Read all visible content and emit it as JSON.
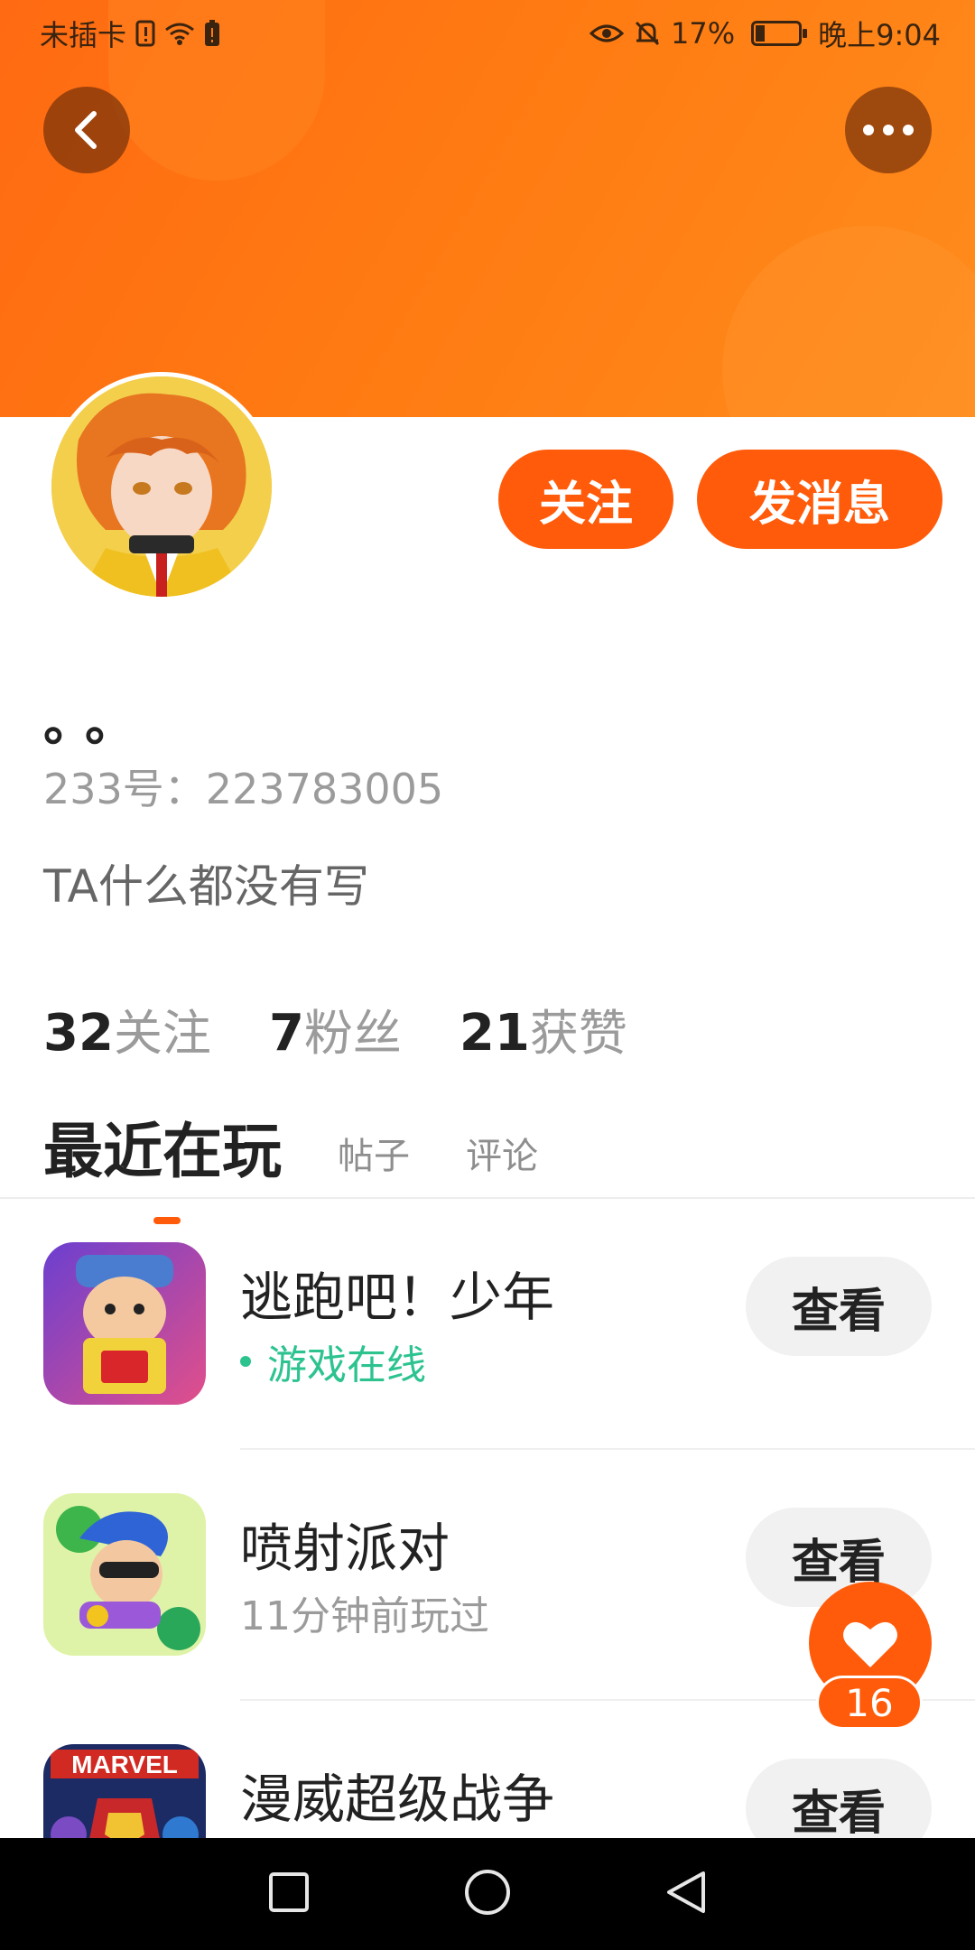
{
  "status_bar": {
    "carrier": "未插卡",
    "battery_percent": "17%",
    "time": "晚上9:04",
    "icons": [
      "sim-alert-icon",
      "wifi-icon",
      "battery-warning-icon",
      "eye-icon",
      "bell-off-icon",
      "battery-icon"
    ]
  },
  "header": {
    "back_icon": "chevron-left-icon",
    "more_icon": "more-horizontal-icon",
    "banner_color": "#ff7a12"
  },
  "profile": {
    "avatar_label": "user avatar",
    "follow_label": "关注",
    "message_label": "发消息",
    "nickname": "。。",
    "uid": "233号：223783005",
    "bio": "TA什么都没有写",
    "stats": [
      {
        "count": "32",
        "label": "关注"
      },
      {
        "count": "7",
        "label": "粉丝"
      },
      {
        "count": "21",
        "label": "获赞"
      }
    ]
  },
  "tabs": [
    {
      "label": "最近在玩",
      "active": true
    },
    {
      "label": "帖子",
      "active": false
    },
    {
      "label": "评论",
      "active": false
    }
  ],
  "games": [
    {
      "title": "逃跑吧！少年",
      "status": "游戏在线",
      "online": true,
      "button": "查看"
    },
    {
      "title": "喷射派对",
      "status": "11分钟前玩过",
      "online": false,
      "button": "查看"
    },
    {
      "title": "漫威超级战争",
      "status": "",
      "online": false,
      "button": "查看"
    }
  ],
  "like_fab": {
    "icon": "heart-icon",
    "count": "16"
  },
  "navbar": {
    "icons": [
      "recent-apps-icon",
      "home-icon",
      "back-triangle-icon"
    ]
  },
  "colors": {
    "accent": "#ff5b0a",
    "online": "#2cc38f"
  }
}
